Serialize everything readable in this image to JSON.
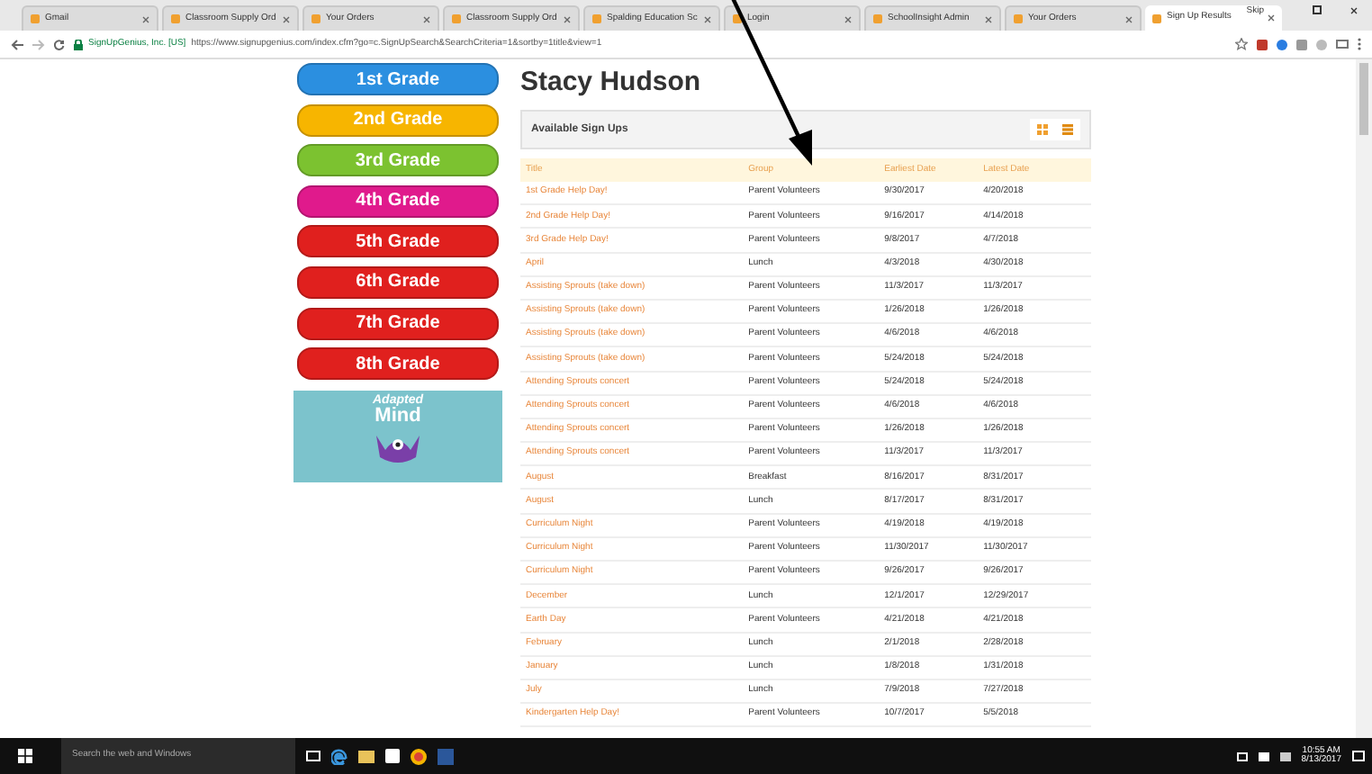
{
  "browser": {
    "tabs": [
      {
        "title": "Gmail",
        "selected": false
      },
      {
        "title": "Classroom Supply Ord",
        "selected": false
      },
      {
        "title": "Your Orders",
        "selected": false
      },
      {
        "title": "Classroom Supply Ord",
        "selected": false
      },
      {
        "title": "Spalding Education Sc",
        "selected": false
      },
      {
        "title": "Login",
        "selected": false
      },
      {
        "title": "SchoolInsight Admin",
        "selected": false
      },
      {
        "title": "Your Orders",
        "selected": false
      },
      {
        "title": "Sign Up Results",
        "selected": true
      }
    ],
    "profile": "Skip",
    "address": {
      "security_label": "SignUpGenius, Inc. [US]",
      "url": "https://www.signupgenius.com/index.cfm?go=c.SignUpSearch&SearchCriteria=1&sortby=1title&view=1"
    }
  },
  "page": {
    "ad": {
      "grades": [
        {
          "label": "1st Grade",
          "color": "#2b8fe0"
        },
        {
          "label": "2nd Grade",
          "color": "#f7b500"
        },
        {
          "label": "3rd Grade",
          "color": "#7cc230"
        },
        {
          "label": "4th Grade",
          "color": "#e01a8c"
        },
        {
          "label": "5th Grade",
          "color": "#e0201e"
        },
        {
          "label": "6th Grade",
          "color": "#e0201e"
        },
        {
          "label": "7th Grade",
          "color": "#e0201e"
        },
        {
          "label": "8th Grade",
          "color": "#e0201e"
        }
      ],
      "promo": {
        "line_1": "Adapted",
        "line_2": "Mind"
      }
    },
    "heading": "Stacy Hudson",
    "panel_title": "Available Sign Ups",
    "table": {
      "columns": [
        "Title",
        "Group",
        "Earliest Date",
        "Latest Date"
      ],
      "rows": [
        [
          "1st Grade Help Day!",
          "Parent Volunteers",
          "9/30/2017",
          "4/20/2018"
        ],
        [
          "2nd Grade Help Day!",
          "Parent Volunteers",
          "9/16/2017",
          "4/14/2018"
        ],
        [
          "3rd Grade Help Day!",
          "Parent Volunteers",
          "9/8/2017",
          "4/7/2018"
        ],
        [
          "April",
          "Lunch",
          "4/3/2018",
          "4/30/2018"
        ],
        [
          "Assisting Sprouts (take down)",
          "Parent Volunteers",
          "11/3/2017",
          "11/3/2017"
        ],
        [
          "Assisting Sprouts (take down)",
          "Parent Volunteers",
          "1/26/2018",
          "1/26/2018"
        ],
        [
          "Assisting Sprouts (take down)",
          "Parent Volunteers",
          "4/6/2018",
          "4/6/2018"
        ],
        [
          "Assisting Sprouts (take down)",
          "Parent Volunteers",
          "5/24/2018",
          "5/24/2018"
        ],
        [
          "Attending Sprouts concert",
          "Parent Volunteers",
          "5/24/2018",
          "5/24/2018"
        ],
        [
          "Attending Sprouts concert",
          "Parent Volunteers",
          "4/6/2018",
          "4/6/2018"
        ],
        [
          "Attending Sprouts concert",
          "Parent Volunteers",
          "1/26/2018",
          "1/26/2018"
        ],
        [
          "Attending Sprouts concert",
          "Parent Volunteers",
          "11/3/2017",
          "11/3/2017"
        ],
        [
          "August",
          "Breakfast",
          "8/16/2017",
          "8/31/2017"
        ],
        [
          "August",
          "Lunch",
          "8/17/2017",
          "8/31/2017"
        ],
        [
          "Curriculum Night",
          "Parent Volunteers",
          "4/19/2018",
          "4/19/2018"
        ],
        [
          "Curriculum Night",
          "Parent Volunteers",
          "11/30/2017",
          "11/30/2017"
        ],
        [
          "Curriculum Night",
          "Parent Volunteers",
          "9/26/2017",
          "9/26/2017"
        ],
        [
          "December",
          "Lunch",
          "12/1/2017",
          "12/29/2017"
        ],
        [
          "Earth Day",
          "Parent Volunteers",
          "4/21/2018",
          "4/21/2018"
        ],
        [
          "February",
          "Lunch",
          "2/1/2018",
          "2/28/2018"
        ],
        [
          "January",
          "Lunch",
          "1/8/2018",
          "1/31/2018"
        ],
        [
          "July",
          "Lunch",
          "7/9/2018",
          "7/27/2018"
        ],
        [
          "Kindergarten Help Day!",
          "Parent Volunteers",
          "10/7/2017",
          "5/5/2018"
        ]
      ]
    }
  },
  "taskbar": {
    "search_placeholder": "Search the web and Windows",
    "time": "10:55 AM",
    "date": "8/13/2017"
  }
}
